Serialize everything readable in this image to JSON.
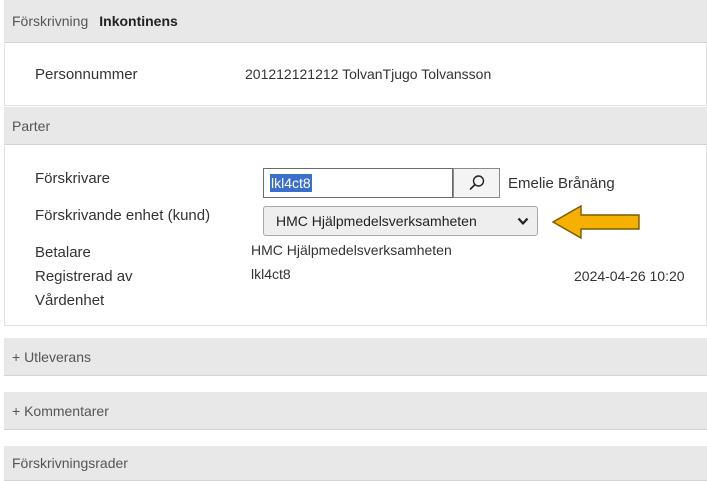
{
  "header": {
    "section": "Förskrivning",
    "title": "Inkontinens"
  },
  "person": {
    "label": "Personnummer",
    "value": "201212121212 TolvanTjugo Tolvansson"
  },
  "parter": {
    "title": "Parter",
    "forskrivare_label": "Förskrivare",
    "forskrivare_value": "lkl4ct8",
    "forskrivare_name": "Emelie Brånäng",
    "enhet_label": "Förskrivande enhet (kund)",
    "enhet_value": "HMC Hjälpmedelsverksamheten",
    "betalare_label": "Betalare",
    "betalare_value": "HMC Hjälpmedelsverksamheten",
    "registrerad_label": "Registrerad av",
    "registrerad_value": "lkl4ct8",
    "registrerad_date": "2024-04-26 10:20",
    "vardenhet_label": "Vårdenhet"
  },
  "sections": {
    "utleverans": "+ Utleverans",
    "kommentarer": "+ Kommentarer",
    "rader": "Förskrivningsrader"
  },
  "icons": {
    "search": "search-icon",
    "dropdown": "chevron-down-icon",
    "pointer": "arrow-left-icon"
  },
  "colors": {
    "arrow": "#f5b000",
    "selection": "#3a6fcc",
    "bar": "#e8e8e8"
  }
}
